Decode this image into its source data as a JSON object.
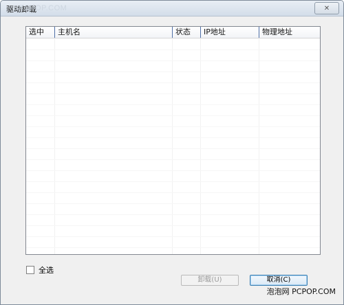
{
  "window": {
    "title": "驱动卸载",
    "watermark": "PCPOP.COM",
    "close_label": "✕"
  },
  "listview": {
    "columns": [
      "选中",
      "主机名",
      "状态",
      "IP地址",
      "物理地址"
    ],
    "rows": []
  },
  "select_all": {
    "label": "全选",
    "checked": false
  },
  "buttons": {
    "uninstall": "卸载(U)",
    "cancel": "取消(C)"
  },
  "footer_watermark": "泡泡网 PCPOP.COM"
}
